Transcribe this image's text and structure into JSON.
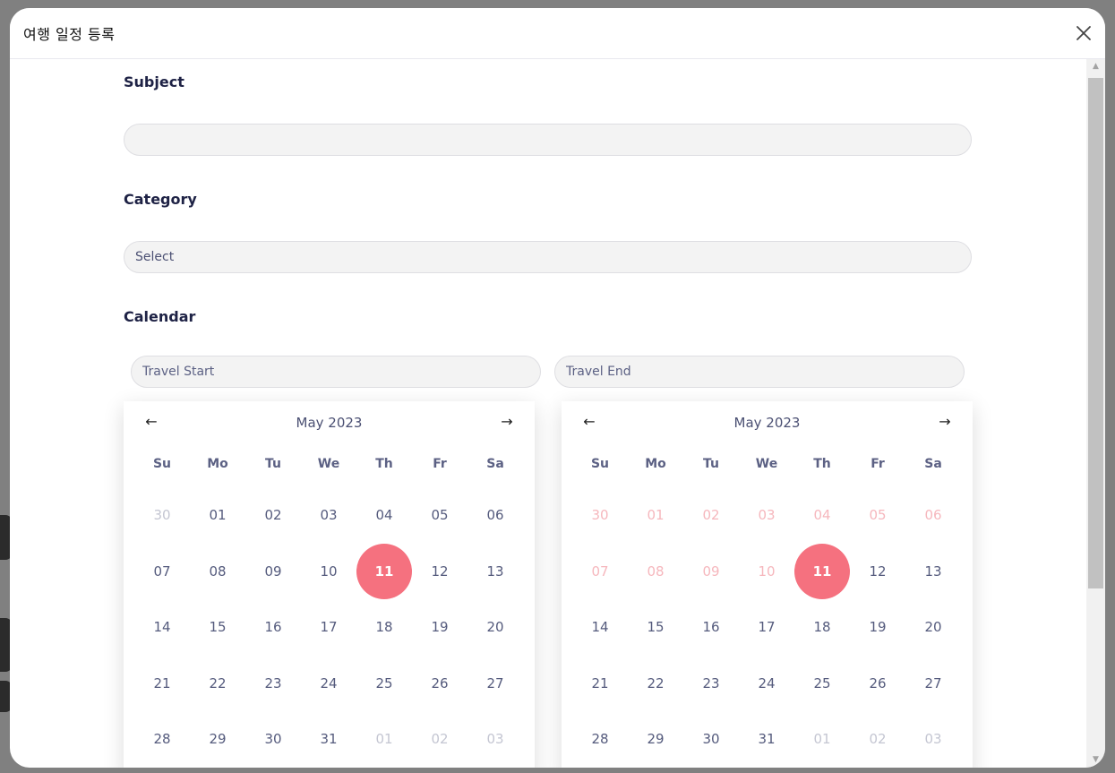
{
  "modal": {
    "title": "여행 일정 등록"
  },
  "form": {
    "subject": {
      "label": "Subject",
      "value": "",
      "placeholder": ""
    },
    "category": {
      "label": "Category",
      "selected": "Select"
    },
    "calendar": {
      "label": "Calendar",
      "start_placeholder": "Travel Start",
      "end_placeholder": "Travel End"
    }
  },
  "calendars": [
    {
      "month": "May 2023",
      "prev": "←",
      "next": "→",
      "weekdays": [
        "Su",
        "Mo",
        "Tu",
        "We",
        "Th",
        "Fr",
        "Sa"
      ],
      "weeks": [
        [
          {
            "d": "30",
            "s": "muted"
          },
          {
            "d": "01"
          },
          {
            "d": "02"
          },
          {
            "d": "03"
          },
          {
            "d": "04"
          },
          {
            "d": "05"
          },
          {
            "d": "06"
          }
        ],
        [
          {
            "d": "07"
          },
          {
            "d": "08"
          },
          {
            "d": "09"
          },
          {
            "d": "10"
          },
          {
            "d": "11",
            "s": "selected"
          },
          {
            "d": "12"
          },
          {
            "d": "13"
          }
        ],
        [
          {
            "d": "14"
          },
          {
            "d": "15"
          },
          {
            "d": "16"
          },
          {
            "d": "17"
          },
          {
            "d": "18"
          },
          {
            "d": "19"
          },
          {
            "d": "20"
          }
        ],
        [
          {
            "d": "21"
          },
          {
            "d": "22"
          },
          {
            "d": "23"
          },
          {
            "d": "24"
          },
          {
            "d": "25"
          },
          {
            "d": "26"
          },
          {
            "d": "27"
          }
        ],
        [
          {
            "d": "28"
          },
          {
            "d": "29"
          },
          {
            "d": "30"
          },
          {
            "d": "31"
          },
          {
            "d": "01",
            "s": "muted"
          },
          {
            "d": "02",
            "s": "muted"
          },
          {
            "d": "03",
            "s": "muted"
          }
        ]
      ]
    },
    {
      "month": "May 2023",
      "prev": "←",
      "next": "→",
      "weekdays": [
        "Su",
        "Mo",
        "Tu",
        "We",
        "Th",
        "Fr",
        "Sa"
      ],
      "weeks": [
        [
          {
            "d": "30",
            "s": "disabled"
          },
          {
            "d": "01",
            "s": "disabled"
          },
          {
            "d": "02",
            "s": "disabled"
          },
          {
            "d": "03",
            "s": "disabled"
          },
          {
            "d": "04",
            "s": "disabled"
          },
          {
            "d": "05",
            "s": "disabled"
          },
          {
            "d": "06",
            "s": "disabled"
          }
        ],
        [
          {
            "d": "07",
            "s": "disabled"
          },
          {
            "d": "08",
            "s": "disabled"
          },
          {
            "d": "09",
            "s": "disabled"
          },
          {
            "d": "10",
            "s": "disabled"
          },
          {
            "d": "11",
            "s": "selected"
          },
          {
            "d": "12"
          },
          {
            "d": "13"
          }
        ],
        [
          {
            "d": "14"
          },
          {
            "d": "15"
          },
          {
            "d": "16"
          },
          {
            "d": "17"
          },
          {
            "d": "18"
          },
          {
            "d": "19"
          },
          {
            "d": "20"
          }
        ],
        [
          {
            "d": "21"
          },
          {
            "d": "22"
          },
          {
            "d": "23"
          },
          {
            "d": "24"
          },
          {
            "d": "25"
          },
          {
            "d": "26"
          },
          {
            "d": "27"
          }
        ],
        [
          {
            "d": "28"
          },
          {
            "d": "29"
          },
          {
            "d": "30"
          },
          {
            "d": "31"
          },
          {
            "d": "01",
            "s": "muted"
          },
          {
            "d": "02",
            "s": "muted"
          },
          {
            "d": "03",
            "s": "muted"
          }
        ]
      ]
    }
  ],
  "colors": {
    "accent": "#f5717f",
    "disabled": "#f6b7bd",
    "muted": "#c4c6d2",
    "label": "#1e2245"
  }
}
